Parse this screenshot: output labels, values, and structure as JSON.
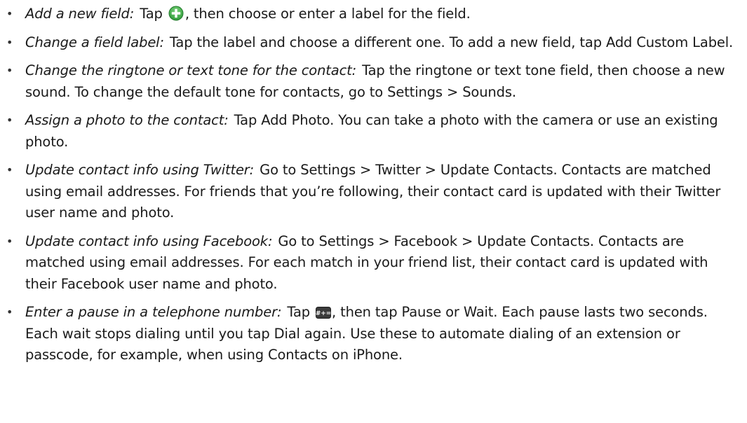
{
  "bullet_char": "•",
  "items": [
    {
      "lead": "Add a new field:",
      "before_icon": "Tap ",
      "icon": "add-circle-icon",
      "after_icon": ", then choose or enter a label for the field."
    },
    {
      "lead": "Change a field label:",
      "text": "Tap the label and choose a different one. To add a new field, tap Add Custom Label."
    },
    {
      "lead": "Change the ringtone or text tone for the contact:",
      "text": "Tap the ringtone or text tone field, then choose a new sound. To change the default tone for contacts, go to Settings > Sounds."
    },
    {
      "lead": "Assign a photo to the contact:",
      "text": "Tap Add Photo. You can take a photo with the camera or use an existing photo."
    },
    {
      "lead": "Update contact info using Twitter:",
      "text": "Go to Settings > Twitter > Update Contacts. Contacts are matched using email addresses. For friends that you’re following, their contact card is updated with their Twitter user name and photo."
    },
    {
      "lead": "Update contact info using Facebook:",
      "text": "Go to Settings > Facebook > Update Contacts. Contacts are matched using email addresses. For each match in your friend list, their contact card is updated with their Facebook user name and photo."
    },
    {
      "lead": "Enter a pause in a telephone number:",
      "before_icon": "Tap ",
      "icon": "symbol-keypad-icon",
      "icon_text": "#+=",
      "after_icon": ", then tap Pause or Wait. Each pause lasts two seconds. Each wait stops dialing until you tap Dial again. Use these to automate dialing of an extension or passcode, for example, when using Contacts on iPhone."
    }
  ],
  "colors": {
    "text": "#1a1a1a",
    "add_icon_fill": "#3fae49",
    "keypad_icon_fill": "#3b3b3b"
  }
}
